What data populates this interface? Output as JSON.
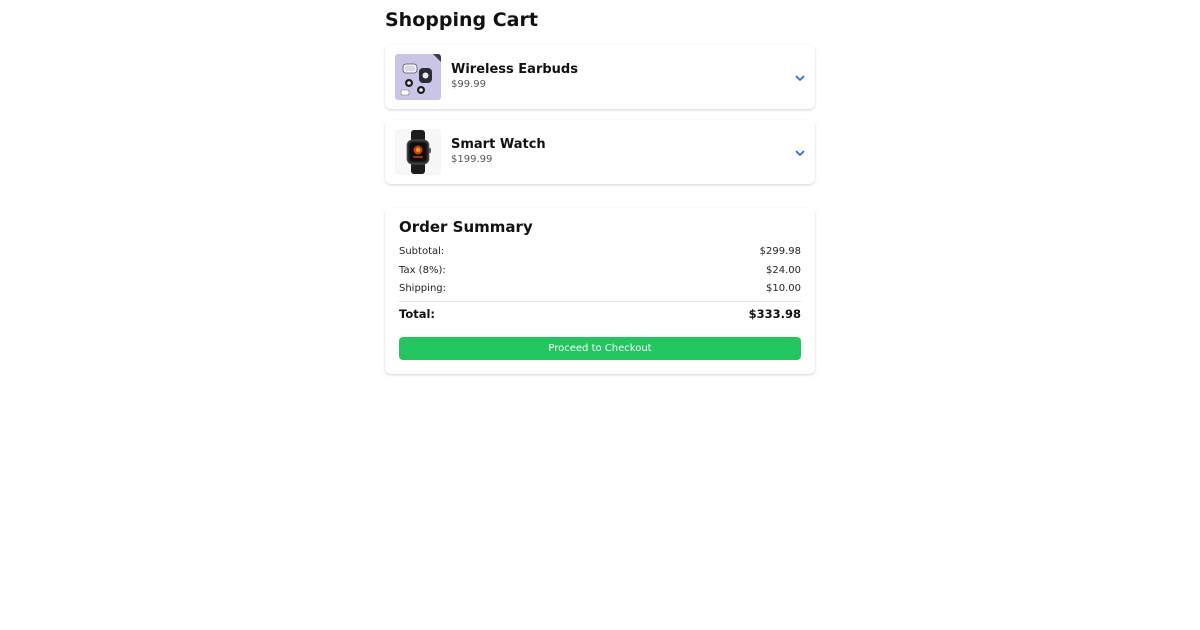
{
  "page": {
    "title": "Shopping Cart"
  },
  "cart": {
    "items": [
      {
        "name": "Wireless Earbuds",
        "price": "$99.99",
        "image": "earbuds-image",
        "expand_icon": "chevron-down-icon"
      },
      {
        "name": "Smart Watch",
        "price": "$199.99",
        "image": "smartwatch-image",
        "expand_icon": "chevron-down-icon"
      }
    ]
  },
  "summary": {
    "title": "Order Summary",
    "subtotal_label": "Subtotal:",
    "subtotal_value": "$299.98",
    "tax_label": "Tax (8%):",
    "tax_value": "$24.00",
    "shipping_label": "Shipping:",
    "shipping_value": "$10.00",
    "total_label": "Total:",
    "total_value": "$333.98",
    "checkout_label": "Proceed to Checkout"
  },
  "colors": {
    "accent": "#2563eb",
    "checkout_button": "#22c55e"
  }
}
